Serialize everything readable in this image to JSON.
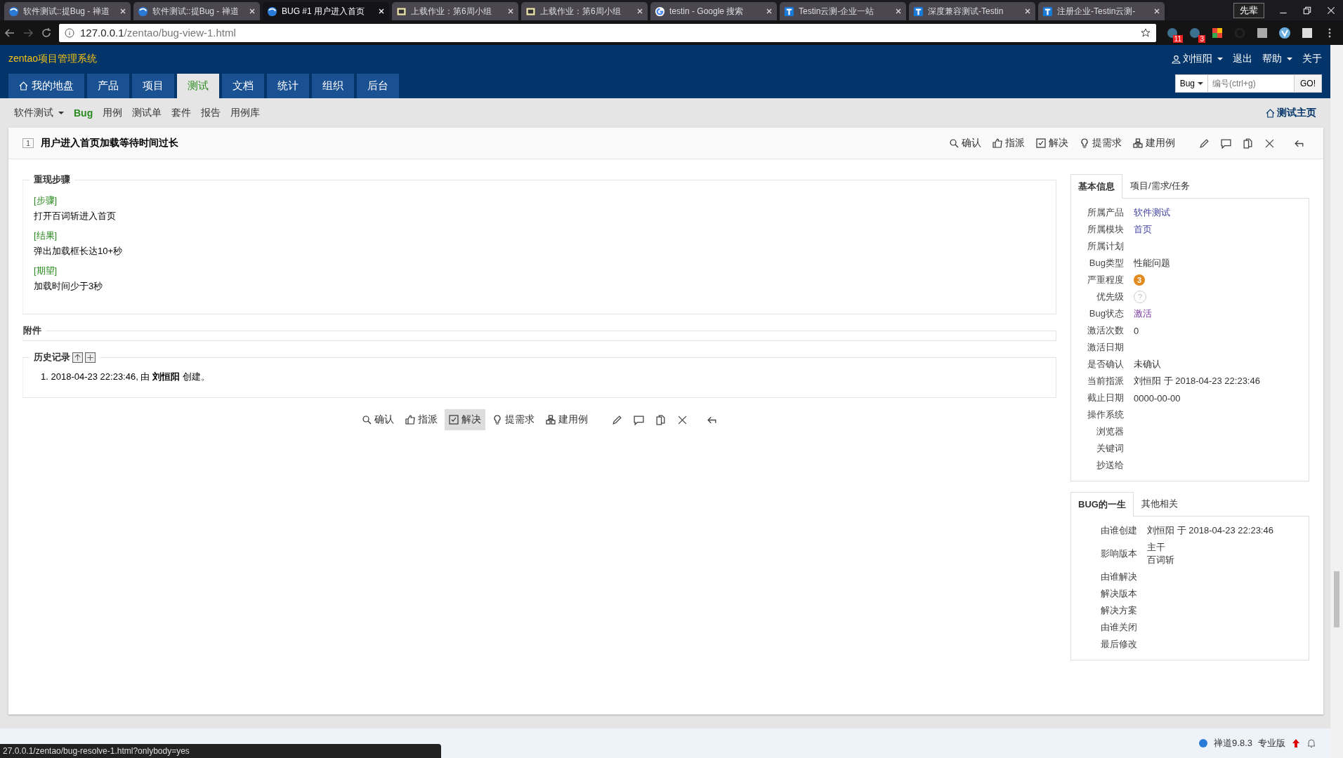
{
  "browser": {
    "tabs": [
      {
        "title": "软件测试::提Bug - 禅道",
        "kind": "globe",
        "selected": false
      },
      {
        "title": "软件测试::提Bug - 禅道",
        "kind": "globe",
        "selected": false
      },
      {
        "title": "BUG #1 用户进入首页",
        "kind": "globe",
        "selected": true
      },
      {
        "title": "上载作业：第6周小组",
        "kind": "bb",
        "selected": false
      },
      {
        "title": "上载作业：第6周小组",
        "kind": "bb",
        "selected": false
      },
      {
        "title": "testin - Google 搜索",
        "kind": "google",
        "selected": false
      },
      {
        "title": "Testin云测-企业一站",
        "kind": "testin",
        "selected": false
      },
      {
        "title": "深度兼容测试-Testin",
        "kind": "testin",
        "selected": false
      },
      {
        "title": "注册企业-Testin云测-",
        "kind": "testin",
        "selected": false
      }
    ],
    "profile": "先辈",
    "url_host": "127.0.0.1",
    "url_path": "/zentao/bug-view-1.html",
    "extension_badges": [
      "11",
      "3"
    ],
    "status_url": "27.0.0.1/zentao/bug-resolve-1.html?onlybody=yes"
  },
  "header": {
    "brand": "zentao项目管理系统",
    "user": "刘恒阳",
    "links": [
      "退出",
      "帮助",
      "关于"
    ],
    "nav": [
      {
        "label": "我的地盘",
        "selected": false
      },
      {
        "label": "产品",
        "selected": false
      },
      {
        "label": "项目",
        "selected": false
      },
      {
        "label": "测试",
        "selected": true
      },
      {
        "label": "文档",
        "selected": false
      },
      {
        "label": "统计",
        "selected": false
      },
      {
        "label": "组织",
        "selected": false
      },
      {
        "label": "后台",
        "selected": false
      }
    ],
    "search": {
      "type": "Bug",
      "placeholder": "编号(ctrl+g)",
      "button": "GO!"
    }
  },
  "subnav": {
    "product": "软件测试",
    "items": [
      {
        "label": "Bug",
        "selected": true
      },
      {
        "label": "用例",
        "selected": false
      },
      {
        "label": "测试单",
        "selected": false
      },
      {
        "label": "套件",
        "selected": false
      },
      {
        "label": "报告",
        "selected": false
      },
      {
        "label": "用例库",
        "selected": false
      }
    ],
    "home": "测试主页"
  },
  "bug": {
    "id": "1",
    "title": "用户进入首页加载等待时间过长",
    "actions": [
      {
        "label": "确认",
        "kind": "search",
        "hover": false
      },
      {
        "label": "指派",
        "kind": "thumb",
        "hover": false
      },
      {
        "label": "解决",
        "kind": "check",
        "hover": false
      },
      {
        "label": "提需求",
        "kind": "bulb",
        "hover": false
      },
      {
        "label": "建用例",
        "kind": "sitemap",
        "hover": false
      }
    ],
    "bottom_actions": [
      {
        "label": "确认",
        "kind": "search",
        "hover": false
      },
      {
        "label": "指派",
        "kind": "thumb",
        "hover": false
      },
      {
        "label": "解决",
        "kind": "check",
        "hover": true
      },
      {
        "label": "提需求",
        "kind": "bulb",
        "hover": false
      },
      {
        "label": "建用例",
        "kind": "sitemap",
        "hover": false
      }
    ],
    "steps_title": "重现步骤",
    "steps": [
      {
        "tag": "[步骤]",
        "text": "打开百词斩进入首页"
      },
      {
        "tag": "[结果]",
        "text": "弹出加载框长达10+秒"
      },
      {
        "tag": "[期望]",
        "text": "加载时间少于3秒"
      }
    ],
    "files_title": "附件",
    "history_title": "历史记录",
    "history": [
      {
        "num": "1.",
        "text": "2018-04-23 22:23:46, 由 **刘恒阳** 创建。"
      }
    ]
  },
  "info": {
    "tabs": [
      {
        "label": "基本信息",
        "selected": true
      },
      {
        "label": "项目/需求/任务",
        "selected": false
      }
    ],
    "rows": [
      {
        "label": "所属产品",
        "value": "软件测试",
        "kind": "link"
      },
      {
        "label": "所属模块",
        "value": "首页",
        "kind": "link"
      },
      {
        "label": "所属计划"
      },
      {
        "label": "Bug类型",
        "value": "性能问题",
        "kind": "text"
      },
      {
        "label": "严重程度",
        "value": "3",
        "kind": "severity"
      },
      {
        "label": "优先级",
        "value": "?",
        "kind": "priority"
      },
      {
        "label": "Bug状态",
        "value": "激活",
        "kind": "status"
      },
      {
        "label": "激活次数",
        "value": "0",
        "kind": "text"
      },
      {
        "label": "激活日期"
      },
      {
        "label": "是否确认",
        "value": "未确认",
        "kind": "text"
      },
      {
        "label": "当前指派",
        "value": "刘恒阳 于 2018-04-23 22:23:46",
        "kind": "text"
      },
      {
        "label": "截止日期",
        "value": "0000-00-00",
        "kind": "text"
      },
      {
        "label": "操作系统"
      },
      {
        "label": "浏览器"
      },
      {
        "label": "关键词"
      },
      {
        "label": "抄送给"
      }
    ]
  },
  "life": {
    "tabs": [
      {
        "label": "BUG的一生",
        "selected": true
      },
      {
        "label": "其他相关",
        "selected": false
      }
    ],
    "rows": [
      {
        "label": "由谁创建",
        "values": [
          "刘恒阳 于 2018-04-23 22:23:46"
        ]
      },
      {
        "label": "影响版本",
        "values": [
          "主干",
          "百词斩"
        ]
      },
      {
        "label": "由谁解决",
        "values": []
      },
      {
        "label": "解决版本",
        "values": []
      },
      {
        "label": "解决方案",
        "values": []
      },
      {
        "label": "由谁关闭",
        "values": []
      },
      {
        "label": "最后修改",
        "values": []
      }
    ]
  },
  "footer": {
    "version": "禅道9.8.3",
    "edition": "专业版"
  }
}
